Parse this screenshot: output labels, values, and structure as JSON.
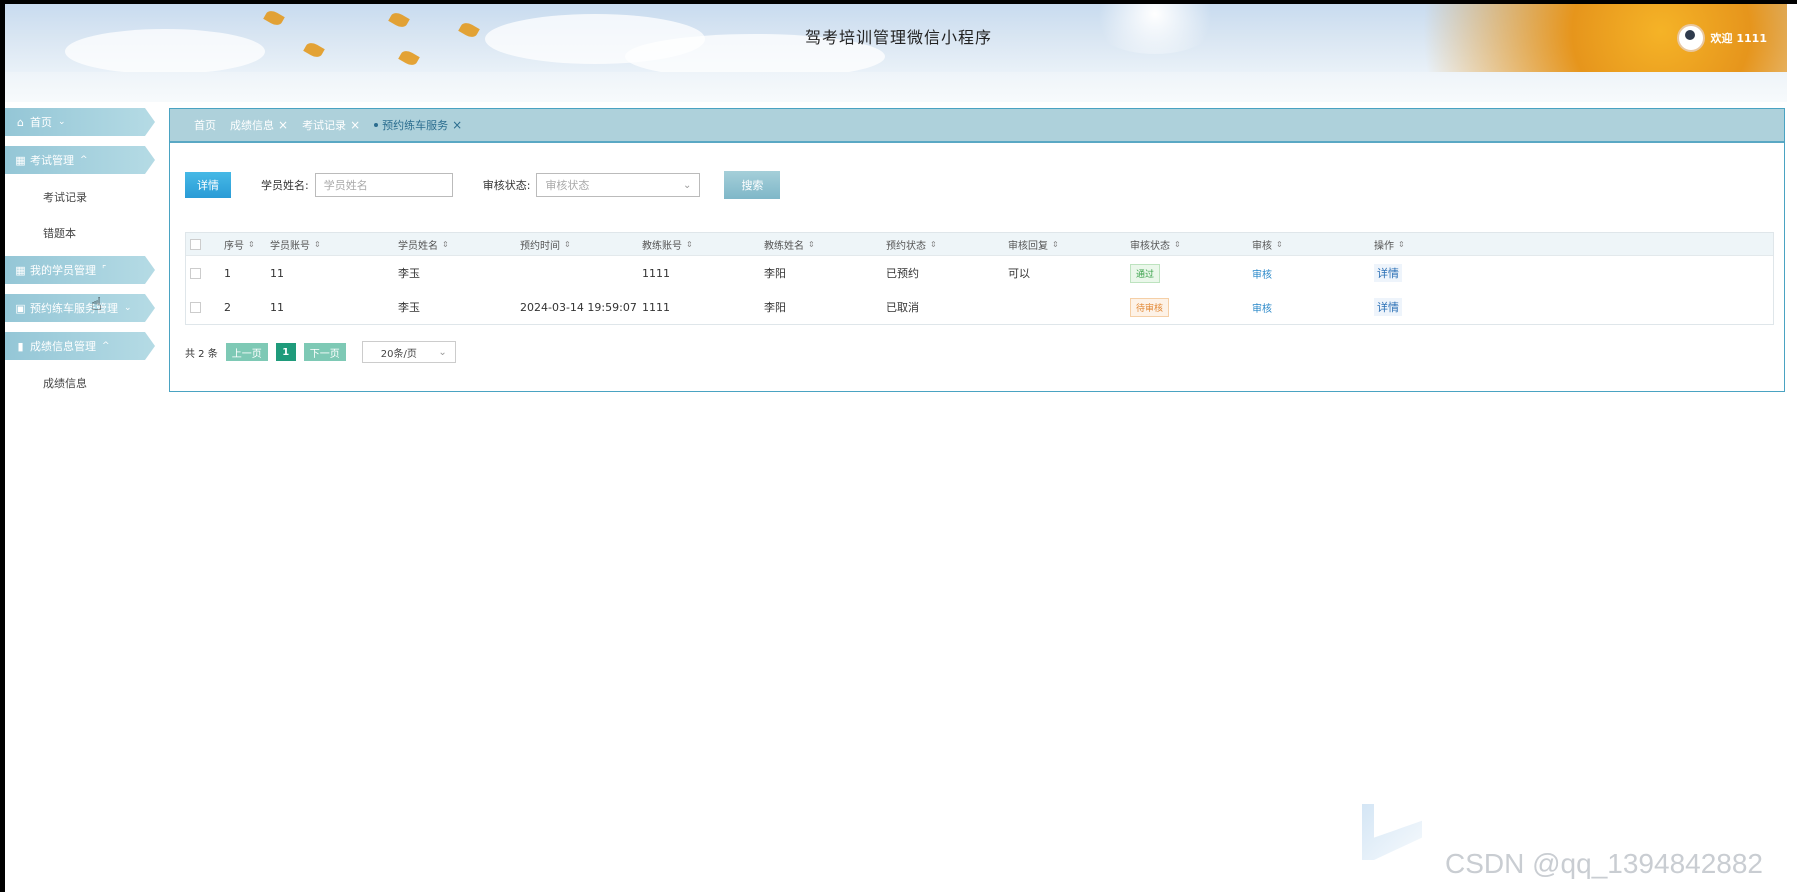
{
  "header": {
    "title": "驾考培训管理微信小程序",
    "welcome": "欢迎 1111"
  },
  "sidebar": {
    "items": [
      {
        "label": "首页",
        "icon": "home-icon"
      },
      {
        "label": "考试管理",
        "icon": "grid-icon",
        "children": [
          "考试记录",
          "错题本"
        ]
      },
      {
        "label": "我的学员管理",
        "icon": "grid-icon"
      },
      {
        "label": "预约练车服务管理",
        "icon": "store-icon"
      },
      {
        "label": "成绩信息管理",
        "icon": "book-icon",
        "children": [
          "成绩信息"
        ]
      }
    ]
  },
  "tabs": [
    "首页",
    "成绩信息",
    "考试记录",
    "预约练车服务"
  ],
  "toolbar": {
    "detail_label": "详情",
    "name_label": "学员姓名:",
    "name_placeholder": "学员姓名",
    "status_label": "审核状态:",
    "status_placeholder": "审核状态",
    "search_label": "搜索"
  },
  "table": {
    "headers": [
      "序号",
      "学员账号",
      "学员姓名",
      "预约时间",
      "教练账号",
      "教练姓名",
      "预约状态",
      "审核回复",
      "审核状态",
      "审核",
      "操作"
    ],
    "rows": [
      {
        "no": "1",
        "account": "11",
        "name": "李玉",
        "time": "",
        "coach_account": "1111",
        "coach_name": "李阳",
        "status": "已预约",
        "reply": "可以",
        "audit_status": "通过",
        "audit": "审核",
        "op": "详情"
      },
      {
        "no": "2",
        "account": "11",
        "name": "李玉",
        "time": "2024-03-14 19:59:07",
        "coach_account": "1111",
        "coach_name": "李阳",
        "status": "已取消",
        "reply": "",
        "audit_status": "待审核",
        "audit": "审核",
        "op": "详情"
      }
    ]
  },
  "pager": {
    "total": "共 2 条",
    "prev": "上一页",
    "current": "1",
    "next": "下一页",
    "page_size": "20条/页"
  },
  "watermark": "CSDN @qq_1394842882",
  "colors": {
    "accent": "#2a9bd6",
    "tab_bar": "#aed1db",
    "pager_green": "#1f9b7b"
  }
}
